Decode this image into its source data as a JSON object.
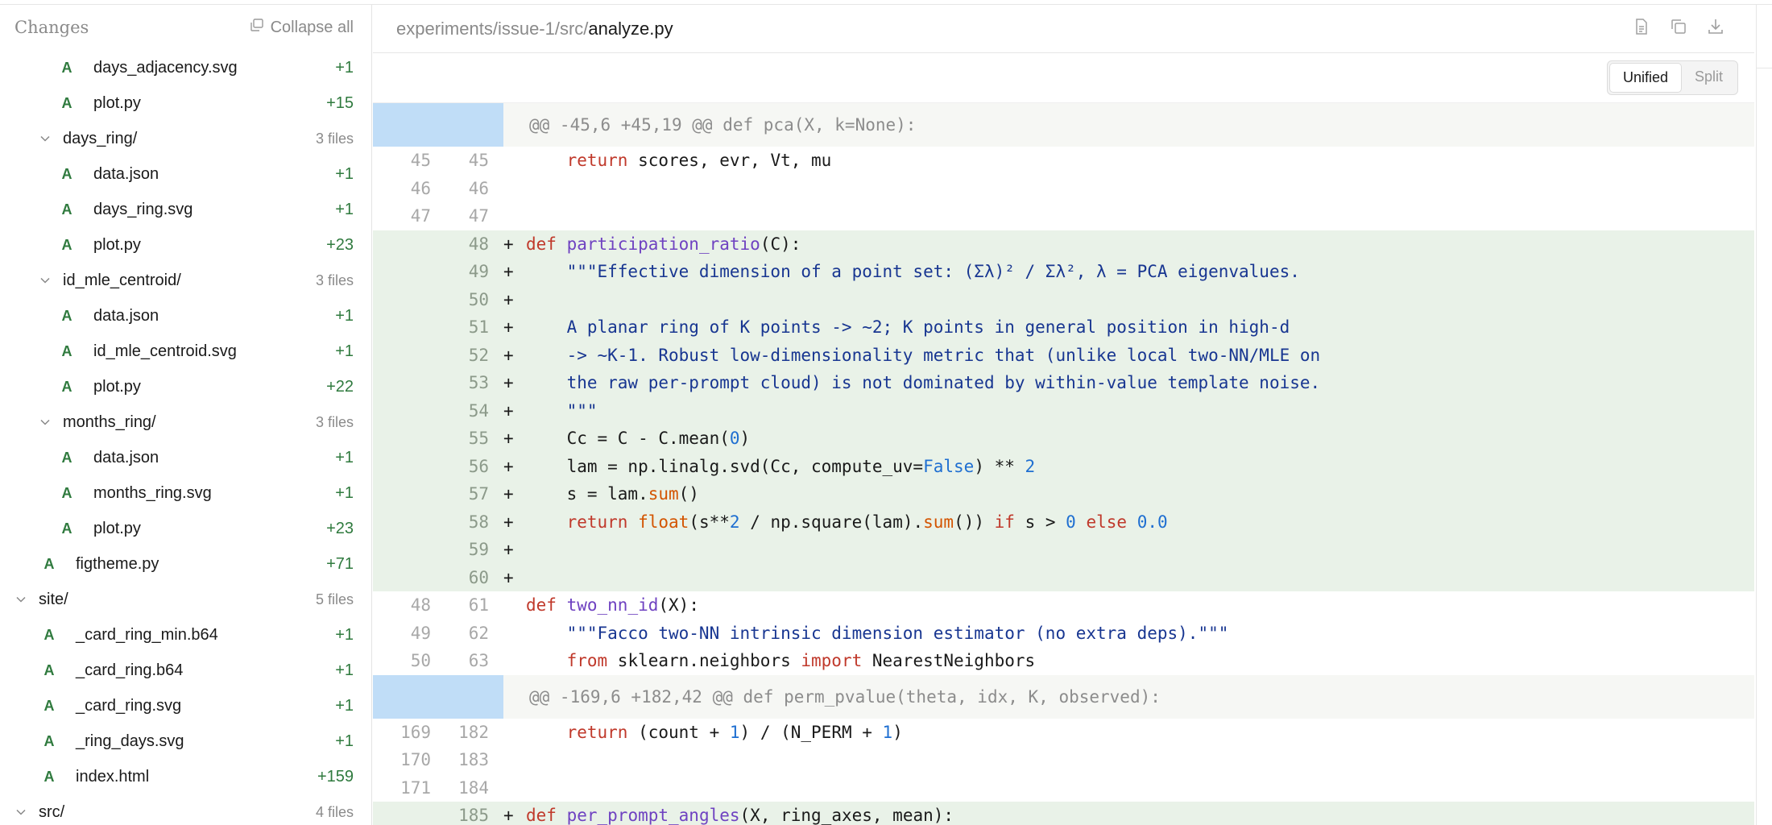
{
  "sidebar": {
    "title": "Changes",
    "collapse_label": "Collapse all",
    "rows": [
      {
        "kind": "file",
        "indent": 2,
        "badge": "A",
        "name": "days_adjacency.svg",
        "count": "+1"
      },
      {
        "kind": "file",
        "indent": 2,
        "badge": "A",
        "name": "plot.py",
        "count": "+15"
      },
      {
        "kind": "dir",
        "indent": 1,
        "name": "days_ring/",
        "count": "3 files"
      },
      {
        "kind": "file",
        "indent": 2,
        "badge": "A",
        "name": "data.json",
        "count": "+1"
      },
      {
        "kind": "file",
        "indent": 2,
        "badge": "A",
        "name": "days_ring.svg",
        "count": "+1"
      },
      {
        "kind": "file",
        "indent": 2,
        "badge": "A",
        "name": "plot.py",
        "count": "+23"
      },
      {
        "kind": "dir",
        "indent": 1,
        "name": "id_mle_centroid/",
        "count": "3 files"
      },
      {
        "kind": "file",
        "indent": 2,
        "badge": "A",
        "name": "data.json",
        "count": "+1"
      },
      {
        "kind": "file",
        "indent": 2,
        "badge": "A",
        "name": "id_mle_centroid.svg",
        "count": "+1"
      },
      {
        "kind": "file",
        "indent": 2,
        "badge": "A",
        "name": "plot.py",
        "count": "+22"
      },
      {
        "kind": "dir",
        "indent": 1,
        "name": "months_ring/",
        "count": "3 files"
      },
      {
        "kind": "file",
        "indent": 2,
        "badge": "A",
        "name": "data.json",
        "count": "+1"
      },
      {
        "kind": "file",
        "indent": 2,
        "badge": "A",
        "name": "months_ring.svg",
        "count": "+1"
      },
      {
        "kind": "file",
        "indent": 2,
        "badge": "A",
        "name": "plot.py",
        "count": "+23"
      },
      {
        "kind": "file",
        "indent": 1,
        "badge": "A",
        "name": "figtheme.py",
        "count": "+71"
      },
      {
        "kind": "dir",
        "indent": 0,
        "name": "site/",
        "count": "5 files"
      },
      {
        "kind": "file",
        "indent": 1,
        "badge": "A",
        "name": "_card_ring_min.b64",
        "count": "+1"
      },
      {
        "kind": "file",
        "indent": 1,
        "badge": "A",
        "name": "_card_ring.b64",
        "count": "+1"
      },
      {
        "kind": "file",
        "indent": 1,
        "badge": "A",
        "name": "_card_ring.svg",
        "count": "+1"
      },
      {
        "kind": "file",
        "indent": 1,
        "badge": "A",
        "name": "_ring_days.svg",
        "count": "+1"
      },
      {
        "kind": "file",
        "indent": 1,
        "badge": "A",
        "name": "index.html",
        "count": "+159"
      },
      {
        "kind": "dir",
        "indent": 0,
        "name": "src/",
        "count": "4 files"
      }
    ]
  },
  "header": {
    "path_prefix": "experiments/issue-1/src/",
    "file_name": "analyze.py"
  },
  "view_toggle": {
    "unified": "Unified",
    "split": "Split"
  },
  "diff": [
    {
      "type": "hunk",
      "text": "@@ -45,6 +45,19 @@ def pca(X, k=None):"
    },
    {
      "type": "ctx",
      "old": "45",
      "new": "45",
      "sign": "",
      "tokens": [
        [
          "p",
          "    "
        ],
        [
          "k",
          "return"
        ],
        [
          "p",
          " scores, evr, Vt, mu"
        ]
      ]
    },
    {
      "type": "ctx",
      "old": "46",
      "new": "46",
      "sign": "",
      "tokens": []
    },
    {
      "type": "ctx",
      "old": "47",
      "new": "47",
      "sign": "",
      "tokens": []
    },
    {
      "type": "add",
      "old": "",
      "new": "48",
      "sign": "+",
      "tokens": [
        [
          "k",
          "def"
        ],
        [
          "p",
          " "
        ],
        [
          "fn",
          "participation_ratio"
        ],
        [
          "p",
          "(C):"
        ]
      ]
    },
    {
      "type": "add",
      "old": "",
      "new": "49",
      "sign": "+",
      "tokens": [
        [
          "str",
          "    \"\"\"Effective dimension of a point set: (Σλ)² / Σλ², λ = PCA eigenvalues."
        ]
      ]
    },
    {
      "type": "add",
      "old": "",
      "new": "50",
      "sign": "+",
      "tokens": []
    },
    {
      "type": "add",
      "old": "",
      "new": "51",
      "sign": "+",
      "tokens": [
        [
          "str",
          "    A planar ring of K points -> ~2; K points in general position in high-d"
        ]
      ]
    },
    {
      "type": "add",
      "old": "",
      "new": "52",
      "sign": "+",
      "tokens": [
        [
          "str",
          "    -> ~K-1. Robust low-dimensionality metric that (unlike local two-NN/MLE on"
        ]
      ]
    },
    {
      "type": "add",
      "old": "",
      "new": "53",
      "sign": "+",
      "tokens": [
        [
          "str",
          "    the raw per-prompt cloud) is not dominated by within-value template noise."
        ]
      ]
    },
    {
      "type": "add",
      "old": "",
      "new": "54",
      "sign": "+",
      "tokens": [
        [
          "str",
          "    \"\"\""
        ]
      ]
    },
    {
      "type": "add",
      "old": "",
      "new": "55",
      "sign": "+",
      "tokens": [
        [
          "p",
          "    Cc = C - C.mean("
        ],
        [
          "num",
          "0"
        ],
        [
          "p",
          ")"
        ]
      ]
    },
    {
      "type": "add",
      "old": "",
      "new": "56",
      "sign": "+",
      "tokens": [
        [
          "p",
          "    lam = np.linalg.svd(Cc, compute_uv="
        ],
        [
          "num",
          "False"
        ],
        [
          "p",
          ") ** "
        ],
        [
          "num",
          "2"
        ]
      ]
    },
    {
      "type": "add",
      "old": "",
      "new": "57",
      "sign": "+",
      "tokens": [
        [
          "p",
          "    s = lam."
        ],
        [
          "bi",
          "sum"
        ],
        [
          "p",
          "()"
        ]
      ]
    },
    {
      "type": "add",
      "old": "",
      "new": "58",
      "sign": "+",
      "tokens": [
        [
          "p",
          "    "
        ],
        [
          "k",
          "return"
        ],
        [
          "p",
          " "
        ],
        [
          "bi",
          "float"
        ],
        [
          "p",
          "(s**"
        ],
        [
          "num",
          "2"
        ],
        [
          "p",
          " / np.square(lam)."
        ],
        [
          "bi",
          "sum"
        ],
        [
          "p",
          "()) "
        ],
        [
          "k",
          "if"
        ],
        [
          "p",
          " s > "
        ],
        [
          "num",
          "0"
        ],
        [
          "p",
          " "
        ],
        [
          "k",
          "else"
        ],
        [
          "p",
          " "
        ],
        [
          "num",
          "0.0"
        ]
      ]
    },
    {
      "type": "add",
      "old": "",
      "new": "59",
      "sign": "+",
      "tokens": []
    },
    {
      "type": "add",
      "old": "",
      "new": "60",
      "sign": "+",
      "tokens": []
    },
    {
      "type": "ctx",
      "old": "48",
      "new": "61",
      "sign": "",
      "tokens": [
        [
          "k",
          "def"
        ],
        [
          "p",
          " "
        ],
        [
          "fn",
          "two_nn_id"
        ],
        [
          "p",
          "(X):"
        ]
      ]
    },
    {
      "type": "ctx",
      "old": "49",
      "new": "62",
      "sign": "",
      "tokens": [
        [
          "str",
          "    \"\"\"Facco two-NN intrinsic dimension estimator (no extra deps).\"\"\""
        ]
      ]
    },
    {
      "type": "ctx",
      "old": "50",
      "new": "63",
      "sign": "",
      "tokens": [
        [
          "p",
          "    "
        ],
        [
          "k",
          "from"
        ],
        [
          "p",
          " sklearn.neighbors "
        ],
        [
          "k",
          "import"
        ],
        [
          "p",
          " NearestNeighbors"
        ]
      ]
    },
    {
      "type": "hunk",
      "text": "@@ -169,6 +182,42 @@ def perm_pvalue(theta, idx, K, observed):"
    },
    {
      "type": "ctx",
      "old": "169",
      "new": "182",
      "sign": "",
      "tokens": [
        [
          "p",
          "    "
        ],
        [
          "k",
          "return"
        ],
        [
          "p",
          " (count + "
        ],
        [
          "num",
          "1"
        ],
        [
          "p",
          ") / (N_PERM + "
        ],
        [
          "num",
          "1"
        ],
        [
          "p",
          ")"
        ]
      ]
    },
    {
      "type": "ctx",
      "old": "170",
      "new": "183",
      "sign": "",
      "tokens": []
    },
    {
      "type": "ctx",
      "old": "171",
      "new": "184",
      "sign": "",
      "tokens": []
    },
    {
      "type": "add",
      "old": "",
      "new": "185",
      "sign": "+",
      "tokens": [
        [
          "k",
          "def"
        ],
        [
          "p",
          " "
        ],
        [
          "fn",
          "per_prompt_angles"
        ],
        [
          "p",
          "(X, ring_axes, mean):"
        ]
      ]
    }
  ]
}
